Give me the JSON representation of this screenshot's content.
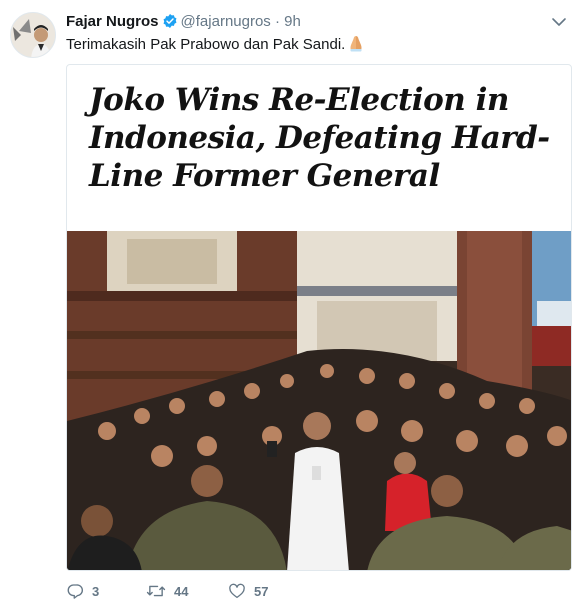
{
  "tweet": {
    "author_name": "Fajar Nugros",
    "handle": "@fajarnugros",
    "separator": "·",
    "time": "9h",
    "text": "Terimakasih Pak Prabowo dan Pak Sandi.",
    "emoji": "folded-hands"
  },
  "card": {
    "headline": "Joko Wins Re-Election in Indonesia, Defeating Hard-Line Former General"
  },
  "actions": {
    "replies": "3",
    "retweets": "44",
    "likes": "57"
  },
  "colors": {
    "verified": "#1da1f2",
    "secondary_text": "#657786",
    "border": "#e1e8ed"
  },
  "icons": [
    "verified-badge-icon",
    "chevron-down-icon",
    "reply-icon",
    "retweet-icon",
    "like-icon"
  ]
}
